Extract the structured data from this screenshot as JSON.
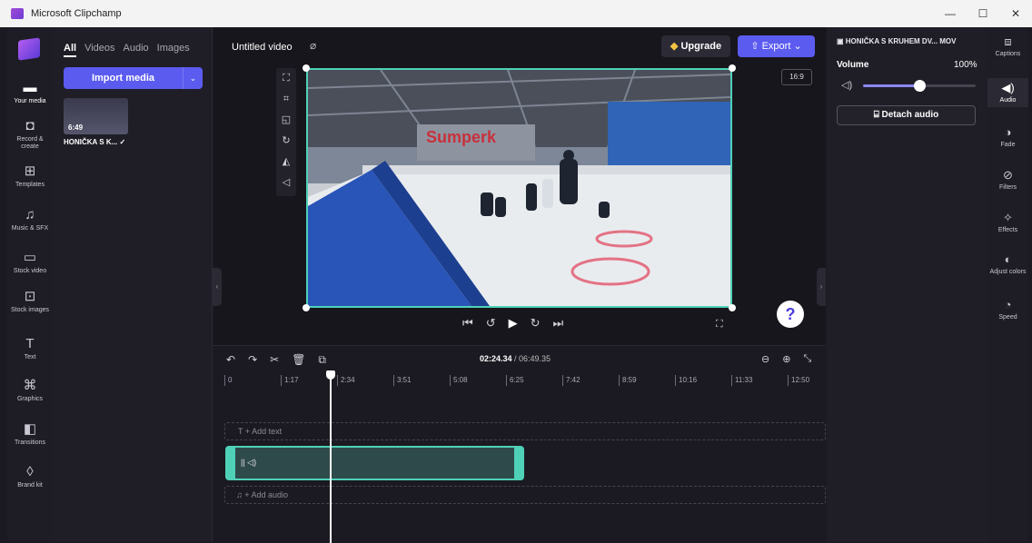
{
  "window": {
    "title": "Microsoft Clipchamp",
    "controls": [
      "—",
      "☐",
      "✕"
    ]
  },
  "left_rail": [
    {
      "label": "Your media",
      "icon": "folder-icon",
      "glyph": "▬"
    },
    {
      "label": "Record & create",
      "icon": "camera-icon",
      "glyph": "◘"
    },
    {
      "label": "Templates",
      "icon": "templates-icon",
      "glyph": "⊞"
    },
    {
      "label": "Music & SFX",
      "icon": "music-icon",
      "glyph": "♫"
    },
    {
      "label": "Stock video",
      "icon": "stock-video-icon",
      "glyph": "▭"
    },
    {
      "label": "Stock images",
      "icon": "stock-images-icon",
      "glyph": "⊡"
    },
    {
      "label": "Text",
      "icon": "text-icon",
      "glyph": "T"
    },
    {
      "label": "Graphics",
      "icon": "graphics-icon",
      "glyph": "⌘"
    },
    {
      "label": "Transitions",
      "icon": "transitions-icon",
      "glyph": "◧"
    },
    {
      "label": "Brand kit",
      "icon": "brand-kit-icon",
      "glyph": "◊"
    }
  ],
  "media": {
    "tabs": [
      "All",
      "Videos",
      "Audio",
      "Images"
    ],
    "import_label": "Import media",
    "import_dropdown": "⌄",
    "item": {
      "duration": "6:49",
      "name": "HONIČKA S K... ✓"
    }
  },
  "project": {
    "title": "Untitled video"
  },
  "toolbar": {
    "upgrade_label": "Upgrade",
    "export_label": "Export",
    "aspect_ratio": "16:9"
  },
  "preview_tools": [
    "⛶",
    "⌗",
    "◱",
    "↻",
    "◭",
    "◁"
  ],
  "playback": [
    "⏮",
    "↺",
    "▶",
    "↻",
    "⏭"
  ],
  "fullscreen_glyph": "⛶",
  "help_glyph": "?",
  "video_scene": {
    "banner_text": "Sumperk"
  },
  "timeline": {
    "tools": [
      "↶",
      "↷",
      "✂",
      "🗑",
      "⧉"
    ],
    "current_time": "02:24.34",
    "total_time": " / 06:49.35",
    "zoom": [
      "⊖",
      "⊕",
      "⤡"
    ],
    "ruler": [
      "0",
      "1:17",
      "2:34",
      "3:51",
      "5:08",
      "6:25",
      "7:42",
      "8:59",
      "10:16",
      "11:33",
      "12:50"
    ],
    "add_text": "T  + Add text",
    "add_audio": "♫ + Add audio",
    "clip_icons": "|| ◁)"
  },
  "properties": {
    "file_name": "HONIČKA S KRUHEM DV... MOV",
    "volume_label": "Volume",
    "volume_value": "100%",
    "volume_fraction": 0.5,
    "detach_label": "Detach audio"
  },
  "right_rail": [
    {
      "label": "Captions",
      "icon": "captions-icon",
      "glyph": "⧈"
    },
    {
      "label": "Audio",
      "icon": "audio-icon",
      "glyph": "◀)"
    },
    {
      "label": "Fade",
      "icon": "fade-icon",
      "glyph": "◑"
    },
    {
      "label": "Filters",
      "icon": "filters-icon",
      "glyph": "⊘"
    },
    {
      "label": "Effects",
      "icon": "effects-icon",
      "glyph": "✧"
    },
    {
      "label": "Adjust colors",
      "icon": "adjust-colors-icon",
      "glyph": "◐"
    },
    {
      "label": "Speed",
      "icon": "speed-icon",
      "glyph": "◔"
    }
  ],
  "colors": {
    "accent": "#5b5bf0",
    "selection": "#4fd1b8",
    "panel": "#1f1e27"
  }
}
